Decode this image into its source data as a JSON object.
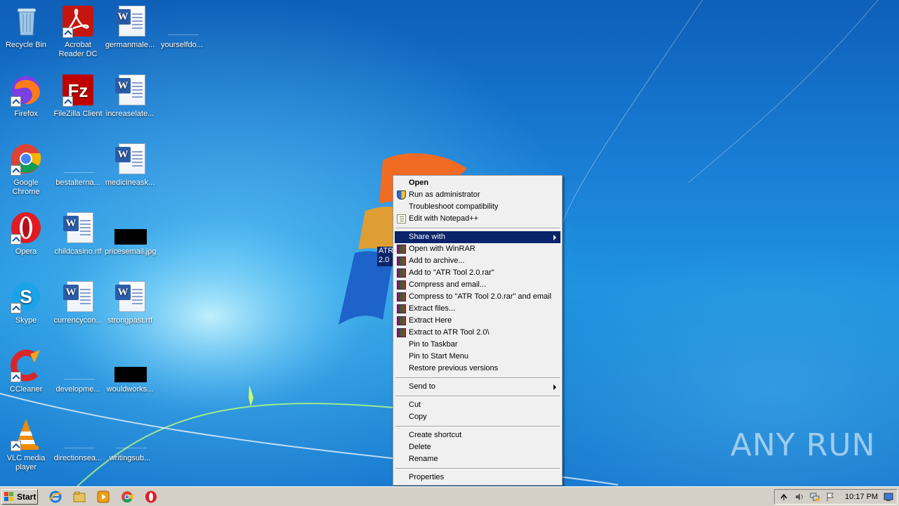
{
  "desktop": {
    "icons": [
      {
        "label": "Recycle Bin",
        "name": "recycle-bin-icon"
      },
      {
        "label": "Acrobat Reader DC",
        "name": "acrobat-reader-icon"
      },
      {
        "label": "germanmale...",
        "name": "word-document-icon"
      },
      {
        "label": "yourselfdo...",
        "name": "file-icon"
      },
      {
        "label": "Firefox",
        "name": "firefox-icon"
      },
      {
        "label": "FileZilla Client",
        "name": "filezilla-icon"
      },
      {
        "label": "increaselate...",
        "name": "word-document-icon"
      },
      {
        "label": "Google Chrome",
        "name": "chrome-icon"
      },
      {
        "label": "bestalterna...",
        "name": "file-icon"
      },
      {
        "label": "medicineask...",
        "name": "word-document-icon"
      },
      {
        "label": "Opera",
        "name": "opera-icon"
      },
      {
        "label": "childcasino.rtf",
        "name": "word-document-icon"
      },
      {
        "label": "pricesemail.jpg",
        "name": "image-file-icon"
      },
      {
        "label": "Skype",
        "name": "skype-icon"
      },
      {
        "label": "currencycon...",
        "name": "word-document-icon"
      },
      {
        "label": "strongpast.rtf",
        "name": "word-document-icon"
      },
      {
        "label": "CCleaner",
        "name": "ccleaner-icon"
      },
      {
        "label": "developme...",
        "name": "file-icon"
      },
      {
        "label": "wouldworks...",
        "name": "image-file-icon"
      },
      {
        "label": "VLC media player",
        "name": "vlc-icon"
      },
      {
        "label": "directionsea...",
        "name": "file-icon"
      },
      {
        "label": "writingsub...",
        "name": "file-icon"
      }
    ],
    "selected_item_label": "ATR 2.0"
  },
  "context_menu": {
    "items": [
      {
        "label": "Open",
        "bold": true
      },
      {
        "label": "Run as administrator",
        "icon": "shield-icon"
      },
      {
        "label": "Troubleshoot compatibility"
      },
      {
        "label": "Edit with Notepad++",
        "icon": "notepad-plus-plus-icon"
      },
      {
        "separator": true
      },
      {
        "label": "Share with",
        "submenu": true,
        "highlighted": true
      },
      {
        "label": "Open with WinRAR",
        "icon": "winrar-icon"
      },
      {
        "label": "Add to archive...",
        "icon": "winrar-icon"
      },
      {
        "label": "Add to \"ATR Tool 2.0.rar\"",
        "icon": "winrar-icon"
      },
      {
        "label": "Compress and email...",
        "icon": "winrar-icon"
      },
      {
        "label": "Compress to \"ATR Tool 2.0.rar\" and email",
        "icon": "winrar-icon"
      },
      {
        "label": "Extract files...",
        "icon": "winrar-icon"
      },
      {
        "label": "Extract Here",
        "icon": "winrar-icon"
      },
      {
        "label": "Extract to ATR Tool 2.0\\",
        "icon": "winrar-icon"
      },
      {
        "label": "Pin to Taskbar"
      },
      {
        "label": "Pin to Start Menu"
      },
      {
        "label": "Restore previous versions"
      },
      {
        "separator": true
      },
      {
        "label": "Send to",
        "submenu": true
      },
      {
        "separator": true
      },
      {
        "label": "Cut"
      },
      {
        "label": "Copy"
      },
      {
        "separator": true
      },
      {
        "label": "Create shortcut"
      },
      {
        "label": "Delete"
      },
      {
        "label": "Rename"
      },
      {
        "separator": true
      },
      {
        "label": "Properties"
      }
    ]
  },
  "taskbar": {
    "start_label": "Start",
    "quick_launch": [
      "internet-explorer-icon",
      "folder-icon",
      "media-player-icon",
      "chrome-icon",
      "opera-icon"
    ],
    "tray_icons": [
      "show-hidden-icons-icon",
      "volume-icon",
      "network-icon",
      "action-center-flag-icon"
    ],
    "clock": "10:17 PM"
  },
  "watermark": "ANY RUN",
  "colors": {
    "menu_highlight": "#0a246a",
    "menu_background": "#f0f0f0",
    "taskbar": "#d4d0c8"
  }
}
